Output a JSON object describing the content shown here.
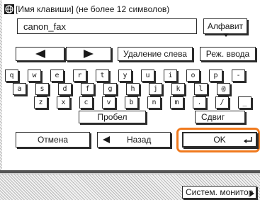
{
  "title": "[Имя клавиши] (не более 12 символов)",
  "input": {
    "value": "canon_fax"
  },
  "alphabet_button": "Алфавит",
  "delete_left_button": "Удаление слева",
  "input_mode_button": "Реж. ввода",
  "keyboard": {
    "row1": [
      "q",
      "w",
      "e",
      "r",
      "t",
      "y",
      "u",
      "i",
      "o",
      "p",
      "-"
    ],
    "row2": [
      "a",
      "s",
      "d",
      "f",
      "g",
      "h",
      "j",
      "k",
      "l",
      "@"
    ],
    "row3": [
      "z",
      "x",
      "c",
      "v",
      "b",
      "n",
      "m",
      ".",
      "/",
      "_"
    ]
  },
  "space_button": "Пробел",
  "shift_button": "Сдвиг",
  "cancel_button": "Отмена",
  "back_button": "Назад",
  "ok_button": "OK",
  "system_monitor_button": "Систем. монитор",
  "colors": {
    "highlight": "#f07a1e",
    "shadow": "#2b2b2b"
  },
  "icons": [
    "globe-icon",
    "left-arrow-icon",
    "right-arrow-icon",
    "dropdown-arrow-icon",
    "enter-icon",
    "chevron-right-icon"
  ]
}
